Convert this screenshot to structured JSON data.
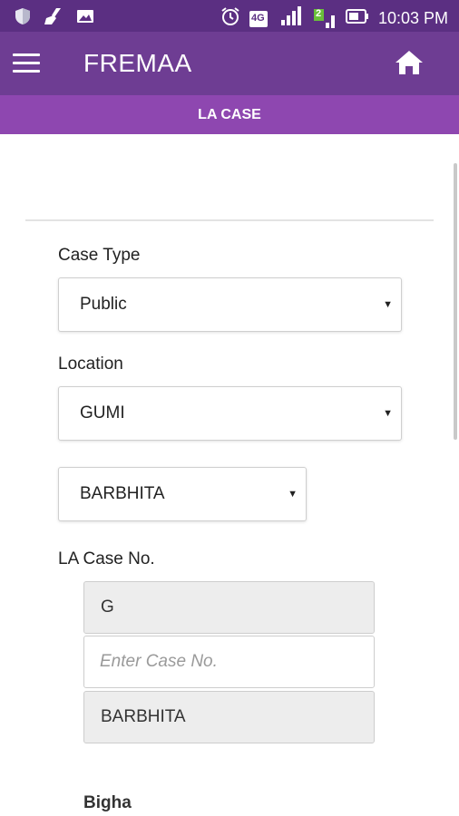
{
  "status_bar": {
    "time": "10:03 PM",
    "network_label": "4G",
    "sim_label": "2"
  },
  "app_bar": {
    "title": "FREMAA"
  },
  "sub_header": {
    "title": "LA CASE"
  },
  "form": {
    "case_type": {
      "label": "Case Type",
      "value": "Public"
    },
    "location": {
      "label": "Location",
      "value": "GUMI"
    },
    "sub_location": {
      "value": "BARBHITA"
    },
    "la_case": {
      "label": "LA Case No.",
      "prefix_value": "G",
      "case_no_placeholder": "Enter Case No.",
      "suffix_value": "BARBHITA"
    },
    "bigha_label": "Bigha"
  },
  "colors": {
    "status_bar": "#5b2f82",
    "app_bar": "#6e3d93",
    "sub_header": "#8e47b0"
  }
}
